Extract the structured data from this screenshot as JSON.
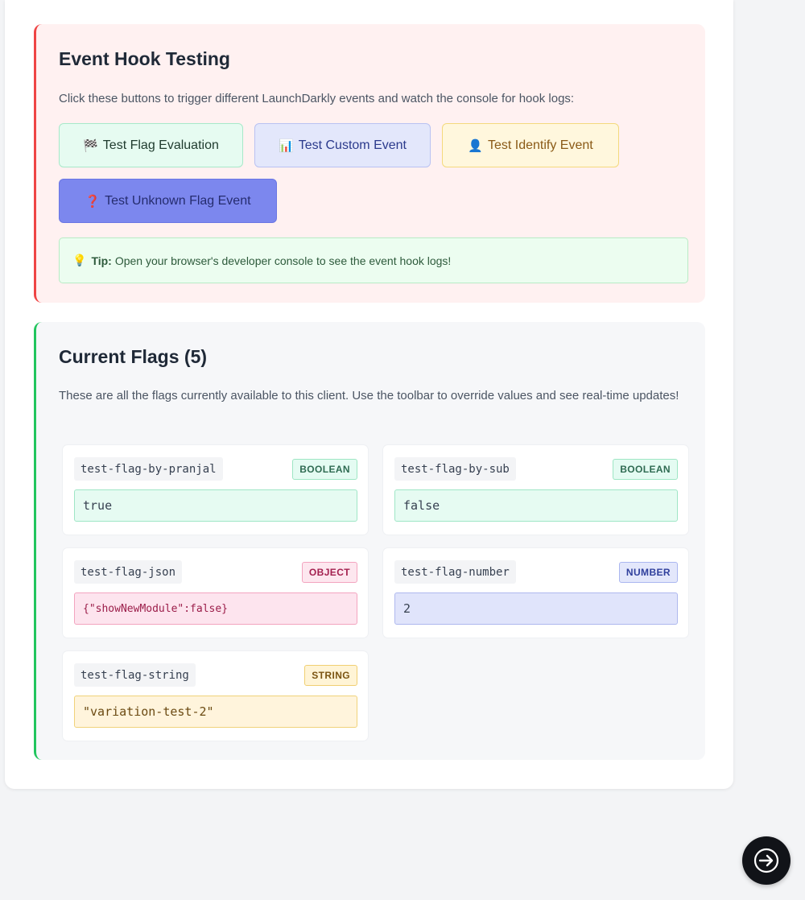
{
  "event_section": {
    "title": "Event Hook Testing",
    "description": "Click these buttons to trigger different LaunchDarkly events and watch the console for hook logs:",
    "buttons": [
      {
        "glyph": "🏁",
        "label": "Test Flag Evaluation"
      },
      {
        "glyph": "📊",
        "label": "Test Custom Event"
      },
      {
        "glyph": "👤",
        "label": "Test Identify Event"
      },
      {
        "glyph": "❓",
        "label": "Test Unknown Flag Event"
      }
    ],
    "tip": {
      "icon": "lightbulb-icon",
      "glyph": "💡",
      "label": "Tip:",
      "text": "Open your browser's developer console to see the event hook logs!"
    }
  },
  "flags_section": {
    "title": "Current Flags (5)",
    "description": "These are all the flags currently available to this client. Use the toolbar to override values and see real-time updates!",
    "flags": [
      {
        "key": "test-flag-by-pranjal",
        "type": "BOOLEAN",
        "value": "true"
      },
      {
        "key": "test-flag-by-sub",
        "type": "BOOLEAN",
        "value": "false"
      },
      {
        "key": "test-flag-json",
        "type": "OBJECT",
        "value": "{\"showNewModule\":false}"
      },
      {
        "key": "test-flag-number",
        "type": "NUMBER",
        "value": "2"
      },
      {
        "key": "test-flag-string",
        "type": "STRING",
        "value": "\"variation-test-2\""
      }
    ]
  },
  "fab": {
    "icon": "arrow-right-circle-icon"
  }
}
